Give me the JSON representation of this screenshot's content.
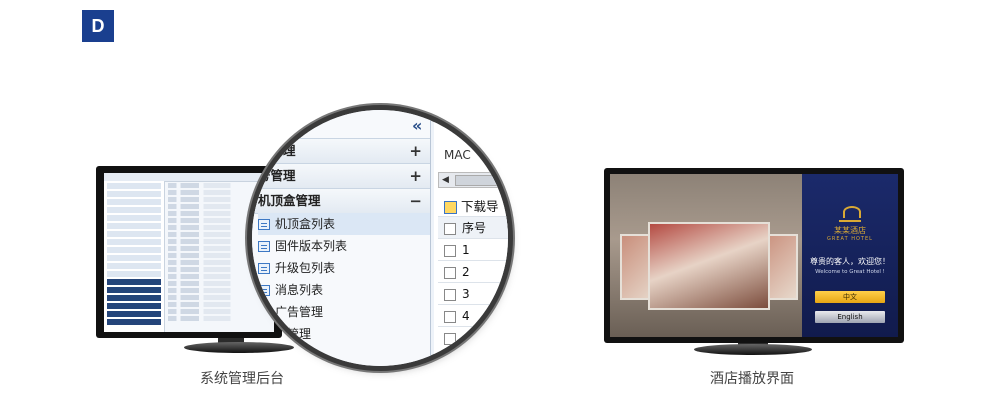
{
  "badge": "D",
  "left_caption": "系统管理后台",
  "right_caption": "酒店播放界面",
  "magnifier": {
    "collapse_icon": "«",
    "groups": [
      {
        "label": "商管理",
        "sign": "+"
      },
      {
        "label": "号管理",
        "sign": "+"
      },
      {
        "label": "机顶盒管理",
        "sign": "−"
      }
    ],
    "items": [
      "机顶盒列表",
      "固件版本列表",
      "升级包列表",
      "消息列表",
      "广告管理",
      "词管理",
      "列表"
    ],
    "mac_label": "MAC",
    "download_label": "下载导",
    "table_header": "序号",
    "rows": [
      "1",
      "2",
      "3",
      "4"
    ]
  },
  "hotel": {
    "name": "某某酒店",
    "sub": "GREAT HOTEL",
    "welcome": "尊贵的客人，欢迎您！",
    "welcome_en": "Welcome to Great Hotel !",
    "btn_cn": "中文",
    "btn_en": "English"
  }
}
